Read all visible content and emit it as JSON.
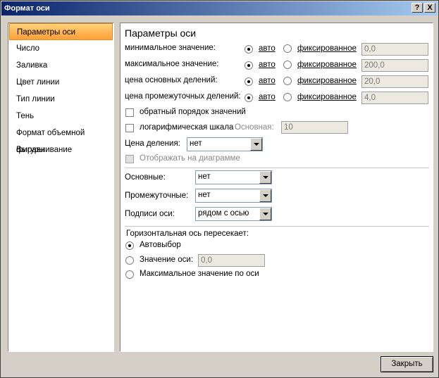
{
  "window": {
    "title": "Формат оси",
    "help_button": "?",
    "close_button": "X"
  },
  "sidebar": {
    "items": [
      {
        "label": "Параметры оси",
        "active": true
      },
      {
        "label": "Число"
      },
      {
        "label": "Заливка"
      },
      {
        "label": "Цвет линии"
      },
      {
        "label": "Тип линии"
      },
      {
        "label": "Тень"
      },
      {
        "label": "Формат объемной фигуры"
      },
      {
        "label": "Выравнивание"
      }
    ]
  },
  "panel": {
    "title": "Параметры оси",
    "rows": [
      {
        "label": "минимальное значение:",
        "auto": "авто",
        "fixed": "фиксированное",
        "value": "0,0"
      },
      {
        "label": "максимальное значение:",
        "auto": "авто",
        "fixed": "фиксированное",
        "value": "200,0"
      },
      {
        "label": "цена основных делений:",
        "auto": "авто",
        "fixed": "фиксированное",
        "value": "20,0"
      },
      {
        "label": "цена промежуточных делений:",
        "auto": "авто",
        "fixed": "фиксированное",
        "value": "4,0"
      }
    ],
    "reverse_order": "обратный порядок значений",
    "log_scale": "логарифмическая шкала",
    "base_label": "Основная:",
    "base_value": "10",
    "display_units_label": "Цена деления:",
    "display_units_value": "нет",
    "show_on_chart": "Отображать на диаграмме",
    "major_label": "Основные:",
    "major_value": "нет",
    "minor_label": "Промежуточные:",
    "minor_value": "нет",
    "axis_labels_label": "Подписи оси:",
    "axis_labels_value": "рядом с осью",
    "cross_title": "Горизонтальная ось пересекает:",
    "cross_auto": "Автовыбор",
    "cross_value_label": "Значение оси:",
    "cross_value": "0,0",
    "cross_max": "Максимальное значение по оси"
  },
  "footer": {
    "close_label": "Закрыть"
  }
}
